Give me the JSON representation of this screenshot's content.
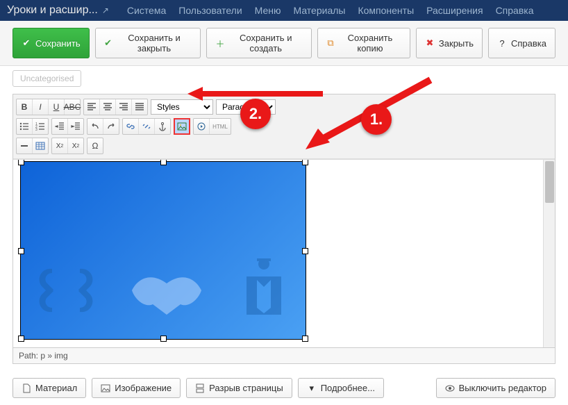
{
  "header": {
    "title": "Уроки и расшир...",
    "menu": [
      "Система",
      "Пользователи",
      "Меню",
      "Материалы",
      "Компоненты",
      "Расширения",
      "Справка"
    ]
  },
  "actions": {
    "save": "Сохранить",
    "save_close": "Сохранить и закрыть",
    "save_new": "Сохранить и создать",
    "save_copy": "Сохранить копию",
    "close": "Закрыть",
    "help": "Справка"
  },
  "tag_faded": "Uncategorised",
  "editor": {
    "styles_label": "Styles",
    "paragraph_label": "Paragraph",
    "path": "Path: p » img"
  },
  "bottom": {
    "material": "Материал",
    "image": "Изображение",
    "pagebreak": "Разрыв страницы",
    "readmore": "Подробнее...",
    "toggle_editor": "Выключить редактор"
  },
  "annotations": {
    "step1": "1.",
    "step2": "2."
  }
}
